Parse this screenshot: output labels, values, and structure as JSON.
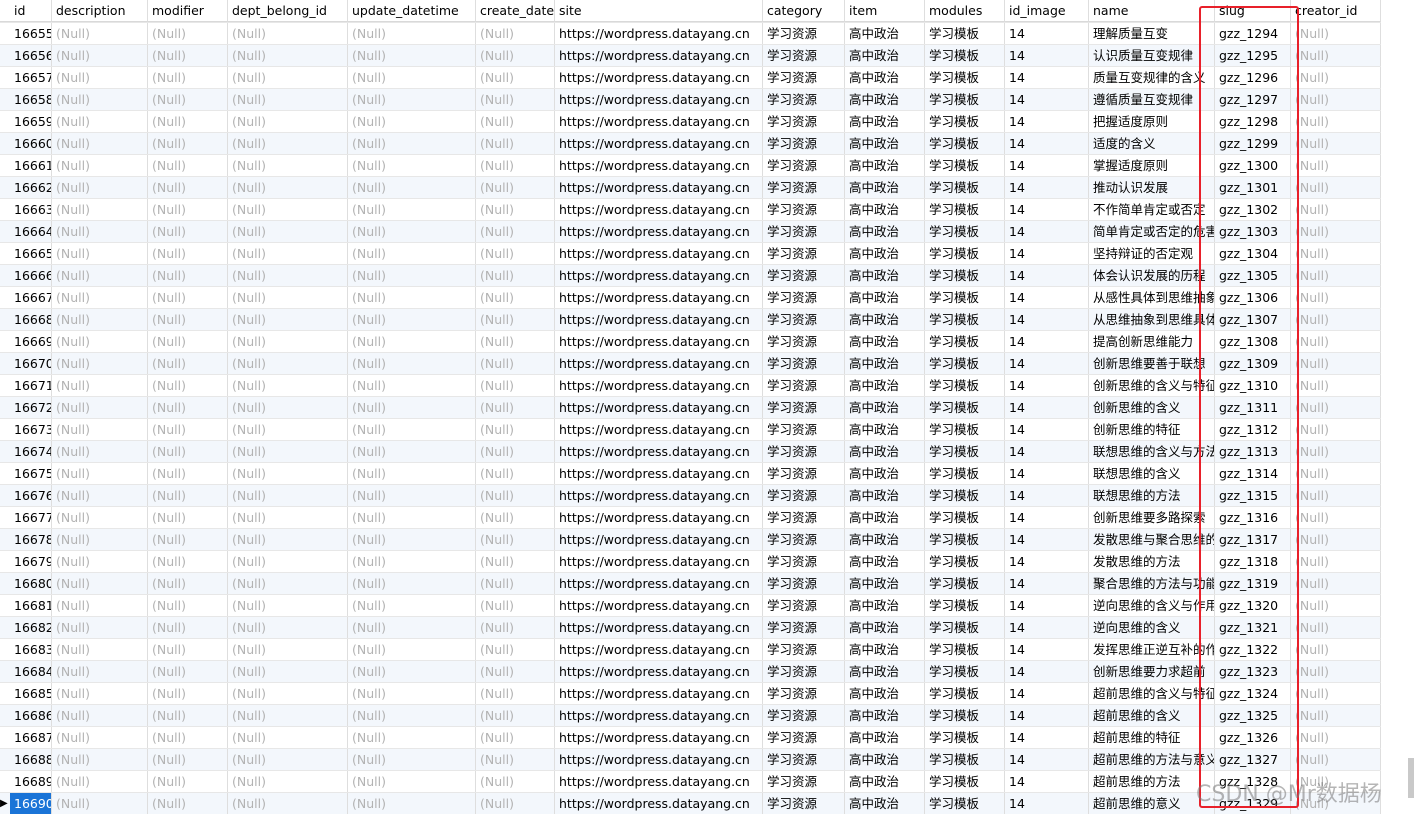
{
  "columns": [
    "id",
    "description",
    "modifier",
    "dept_belong_id",
    "update_datetime",
    "create_dateti",
    "site",
    "category",
    "item",
    "modules",
    "id_image",
    "name",
    "slug",
    "creator_id"
  ],
  "null_text": "(Null)",
  "site": "https://wordpress.datayang.cn",
  "category": "学习资源",
  "item": "高中政治",
  "modules": "学习模板",
  "id_image": "14",
  "rows": [
    {
      "id": "16655",
      "name": "理解质量互变",
      "slug": "gzz_1294"
    },
    {
      "id": "16656",
      "name": "认识质量互变规律",
      "slug": "gzz_1295"
    },
    {
      "id": "16657",
      "name": "质量互变规律的含义",
      "slug": "gzz_1296"
    },
    {
      "id": "16658",
      "name": "遵循质量互变规律",
      "slug": "gzz_1297"
    },
    {
      "id": "16659",
      "name": "把握适度原则",
      "slug": "gzz_1298"
    },
    {
      "id": "16660",
      "name": "适度的含义",
      "slug": "gzz_1299"
    },
    {
      "id": "16661",
      "name": "掌握适度原则",
      "slug": "gzz_1300"
    },
    {
      "id": "16662",
      "name": "推动认识发展",
      "slug": "gzz_1301"
    },
    {
      "id": "16663",
      "name": "不作简单肯定或否定",
      "slug": "gzz_1302"
    },
    {
      "id": "16664",
      "name": "简单肯定或否定的危害",
      "slug": "gzz_1303"
    },
    {
      "id": "16665",
      "name": "坚持辩证的否定观",
      "slug": "gzz_1304"
    },
    {
      "id": "16666",
      "name": "体会认识发展的历程",
      "slug": "gzz_1305"
    },
    {
      "id": "16667",
      "name": "从感性具体到思维抽象",
      "slug": "gzz_1306"
    },
    {
      "id": "16668",
      "name": "从思维抽象到思维具体",
      "slug": "gzz_1307"
    },
    {
      "id": "16669",
      "name": "提高创新思维能力",
      "slug": "gzz_1308"
    },
    {
      "id": "16670",
      "name": "创新思维要善于联想",
      "slug": "gzz_1309"
    },
    {
      "id": "16671",
      "name": "创新思维的含义与特征",
      "slug": "gzz_1310"
    },
    {
      "id": "16672",
      "name": "创新思维的含义",
      "slug": "gzz_1311"
    },
    {
      "id": "16673",
      "name": "创新思维的特征",
      "slug": "gzz_1312"
    },
    {
      "id": "16674",
      "name": "联想思维的含义与方法",
      "slug": "gzz_1313"
    },
    {
      "id": "16675",
      "name": "联想思维的含义",
      "slug": "gzz_1314"
    },
    {
      "id": "16676",
      "name": "联想思维的方法",
      "slug": "gzz_1315"
    },
    {
      "id": "16677",
      "name": "创新思维要多路探索",
      "slug": "gzz_1316"
    },
    {
      "id": "16678",
      "name": "发散思维与聚合思维的方",
      "slug": "gzz_1317"
    },
    {
      "id": "16679",
      "name": "发散思维的方法",
      "slug": "gzz_1318"
    },
    {
      "id": "16680",
      "name": "聚合思维的方法与功能",
      "slug": "gzz_1319"
    },
    {
      "id": "16681",
      "name": "逆向思维的含义与作用",
      "slug": "gzz_1320"
    },
    {
      "id": "16682",
      "name": "逆向思维的含义",
      "slug": "gzz_1321"
    },
    {
      "id": "16683",
      "name": "发挥思维正逆互补的作用",
      "slug": "gzz_1322"
    },
    {
      "id": "16684",
      "name": "创新思维要力求超前",
      "slug": "gzz_1323"
    },
    {
      "id": "16685",
      "name": "超前思维的含义与特征",
      "slug": "gzz_1324"
    },
    {
      "id": "16686",
      "name": "超前思维的含义",
      "slug": "gzz_1325"
    },
    {
      "id": "16687",
      "name": "超前思维的特征",
      "slug": "gzz_1326"
    },
    {
      "id": "16688",
      "name": "超前思维的方法与意义",
      "slug": "gzz_1327"
    },
    {
      "id": "16689",
      "name": "超前思维的方法",
      "slug": "gzz_1328"
    },
    {
      "id": "16690",
      "name": "超前思维的意义",
      "slug": "gzz_1329"
    }
  ],
  "current_row_id": "16690",
  "watermark": "CSDN @Mr数据杨",
  "colors": {
    "highlight_box": "#e8202a",
    "selected_row": "#1a74d7",
    "null_text": "#b3b3b3",
    "alt_row": "#f3f7fc"
  }
}
